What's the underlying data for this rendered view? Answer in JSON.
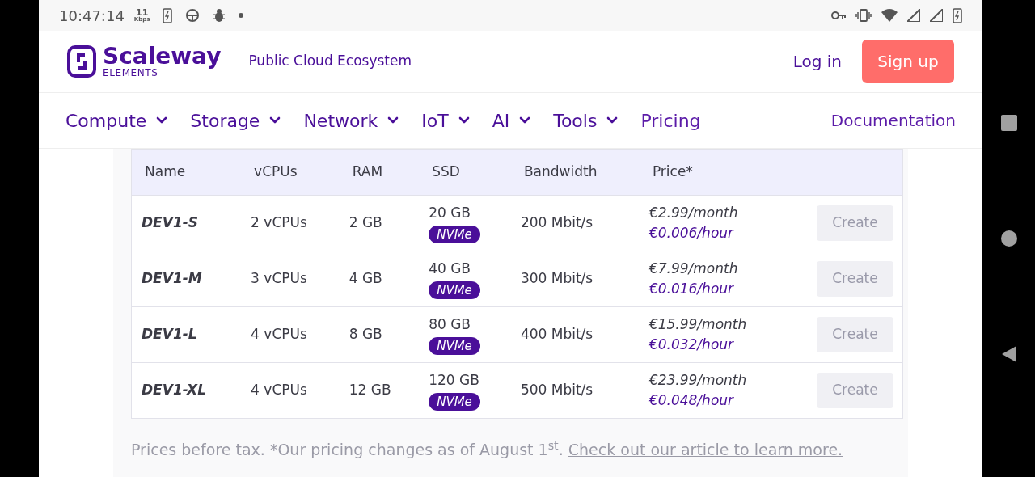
{
  "status_bar": {
    "time": "10:47:14",
    "speed_value": "11",
    "speed_unit": "Kbps"
  },
  "header": {
    "logo_name": "Scaleway",
    "logo_sub": "ELEMENTS",
    "tagline": "Public Cloud Ecosystem",
    "login": "Log in",
    "signup": "Sign up"
  },
  "nav": [
    {
      "label": "Compute",
      "kind": "dropdown"
    },
    {
      "label": "Storage",
      "kind": "dropdown"
    },
    {
      "label": "Network",
      "kind": "dropdown"
    },
    {
      "label": "IoT",
      "kind": "dropdown"
    },
    {
      "label": "AI",
      "kind": "dropdown"
    },
    {
      "label": "Tools",
      "kind": "dropdown"
    },
    {
      "label": "Pricing",
      "kind": "link"
    }
  ],
  "nav_right": "Documentation",
  "table": {
    "columns": [
      "Name",
      "vCPUs",
      "RAM",
      "SSD",
      "Bandwidth",
      "Price*"
    ],
    "rows": [
      {
        "name": "DEV1-S",
        "vcpus": "2 vCPUs",
        "ram": "2 GB",
        "ssd": "20 GB",
        "ssd_type": "NVMe",
        "bandwidth": "200 Mbit/s",
        "price_month": "€2.99/month",
        "price_hour": "€0.006/hour",
        "action": "Create",
        "disabled": true
      },
      {
        "name": "DEV1-M",
        "vcpus": "3 vCPUs",
        "ram": "4 GB",
        "ssd": "40 GB",
        "ssd_type": "NVMe",
        "bandwidth": "300 Mbit/s",
        "price_month": "€7.99/month",
        "price_hour": "€0.016/hour",
        "action": "Create",
        "disabled": true
      },
      {
        "name": "DEV1-L",
        "vcpus": "4 vCPUs",
        "ram": "8 GB",
        "ssd": "80 GB",
        "ssd_type": "NVMe",
        "bandwidth": "400 Mbit/s",
        "price_month": "€15.99/month",
        "price_hour": "€0.032/hour",
        "action": "Create",
        "disabled": true
      },
      {
        "name": "DEV1-XL",
        "vcpus": "4 vCPUs",
        "ram": "12 GB",
        "ssd": "120 GB",
        "ssd_type": "NVMe",
        "bandwidth": "500 Mbit/s",
        "price_month": "€23.99/month",
        "price_hour": "€0.048/hour",
        "action": "Create",
        "disabled": true
      }
    ]
  },
  "footnote": {
    "text": "Prices before tax. *Our pricing changes as of August 1$^{st}$.",
    "link": "Check out our article to learn more."
  }
}
